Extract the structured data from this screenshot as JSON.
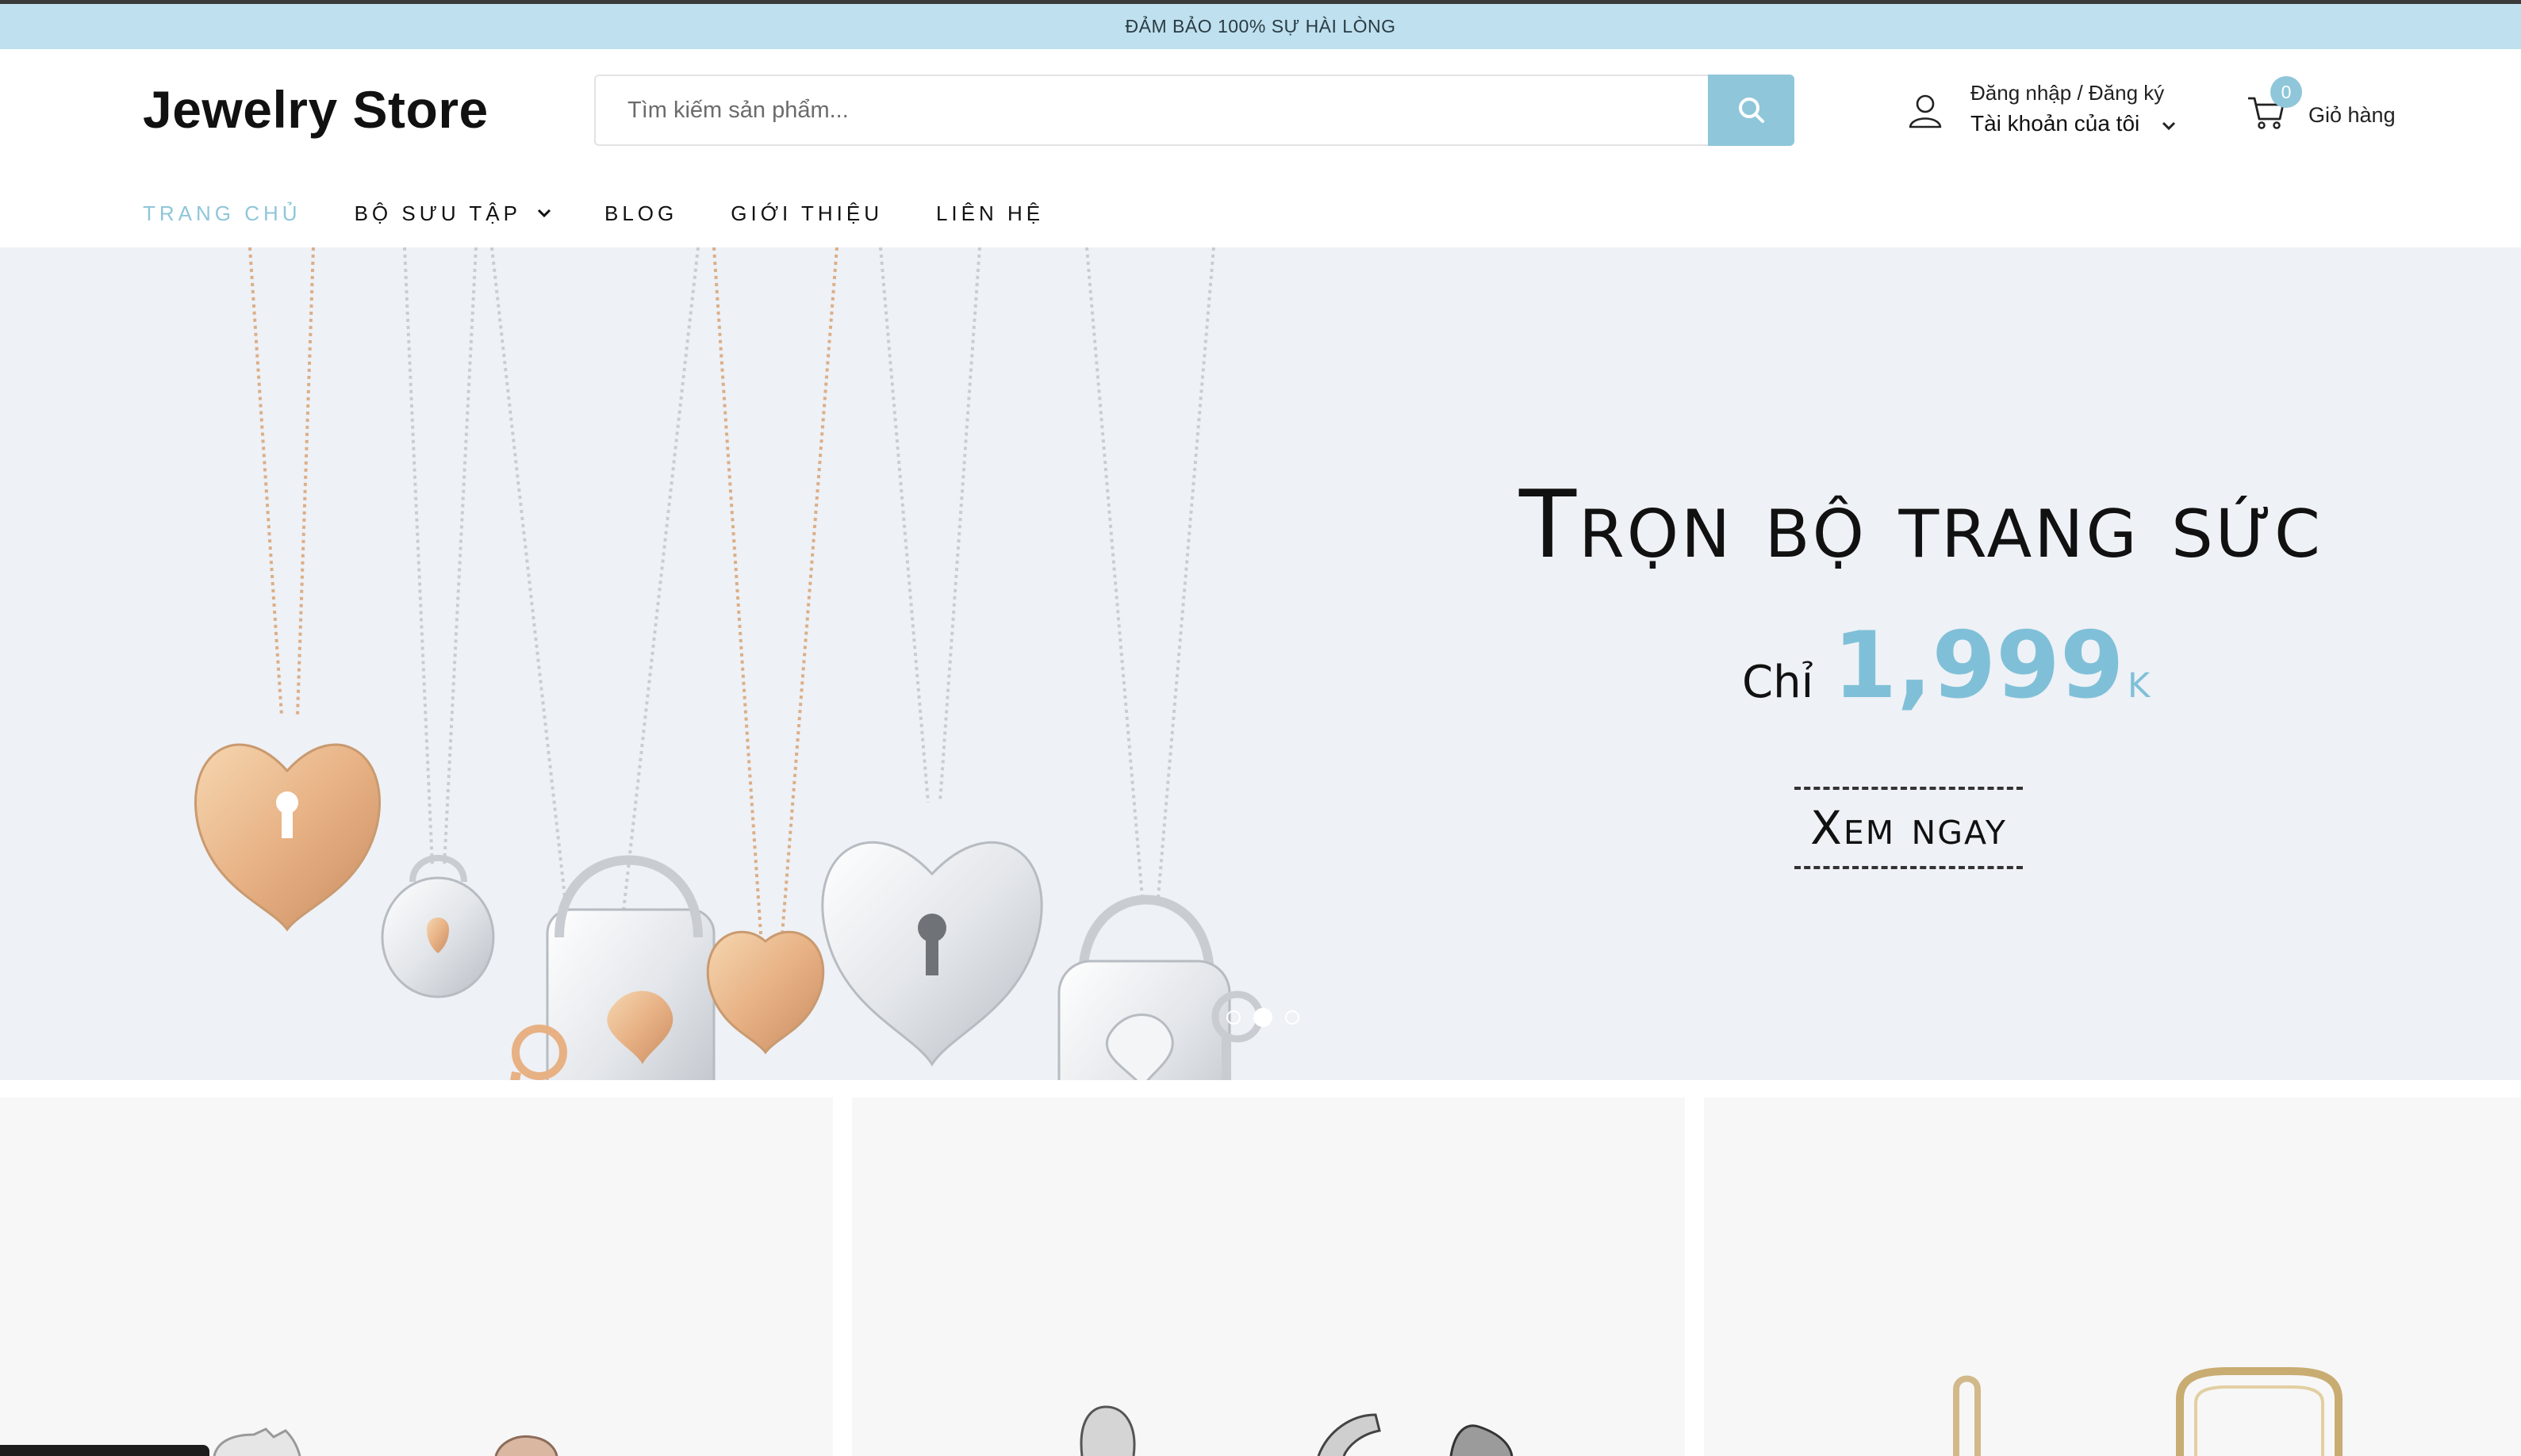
{
  "announcement": "ĐẢM BẢO 100% SỰ HÀI LÒNG",
  "header": {
    "logo": "Jewelry Store",
    "search": {
      "placeholder": "Tìm kiếm sản phẩm..."
    },
    "account": {
      "line1": "Đăng nhập / Đăng ký",
      "line2": "Tài khoản của tôi"
    },
    "cart": {
      "count": "0",
      "label": "Giỏ hàng"
    }
  },
  "nav": {
    "items": [
      {
        "label": "TRANG CHỦ",
        "active": true
      },
      {
        "label": "BỘ SƯU TẬP",
        "has_dropdown": true
      },
      {
        "label": "BLOG"
      },
      {
        "label": "GIỚI THIỆU"
      },
      {
        "label": "LIÊN HỆ"
      }
    ]
  },
  "hero": {
    "title": "Trọn bộ trang sức",
    "price_prefix": "Chỉ",
    "price_value": "1,999",
    "price_unit": "k",
    "cta": "Xem ngay",
    "slides": 3,
    "active_slide": 2
  },
  "colors": {
    "accent": "#8fc6da",
    "announcement_bg": "#bfe0ee",
    "hero_bg": "#eef1f6"
  },
  "icons": [
    "search-icon",
    "user-icon",
    "cart-icon",
    "chevron-down-icon"
  ]
}
